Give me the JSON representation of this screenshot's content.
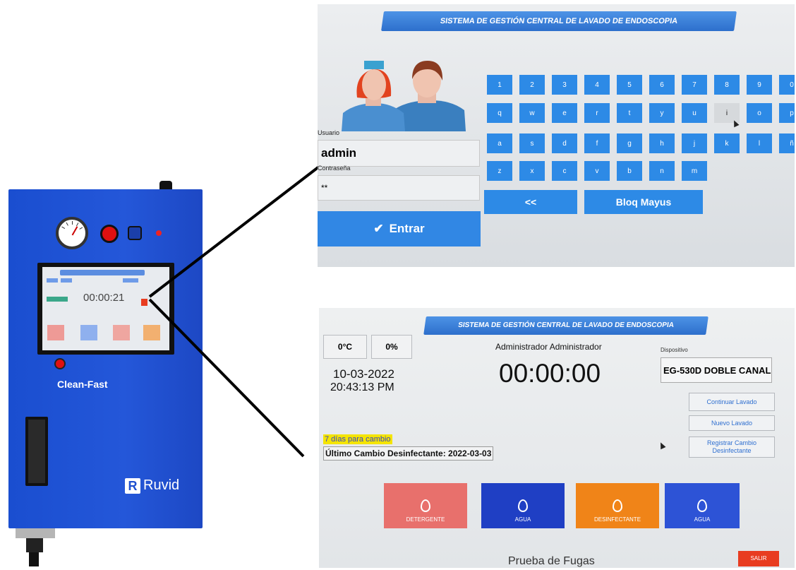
{
  "device": {
    "brand_label": "Clean-Fast",
    "logo_text": "Ruvid",
    "logo_mark": "R",
    "mini_screen_timer": "00:00:21",
    "body_color": "#1f50d0"
  },
  "login_screen": {
    "banner_title": "SISTEMA DE GESTIÓN CENTRAL DE LAVADO DE ENDOSCOPIA",
    "user_label": "Usuario",
    "user_value": "admin",
    "password_label": "Contraseña",
    "password_value": "**",
    "enter_button": "Entrar",
    "enter_icon": "check-icon",
    "keyboard": {
      "rows": [
        [
          "1",
          "2",
          "3",
          "4",
          "5",
          "6",
          "7",
          "8",
          "9",
          "0"
        ],
        [
          "q",
          "w",
          "e",
          "r",
          "t",
          "y",
          "u",
          "i",
          "o",
          "p"
        ],
        [
          "a",
          "s",
          "d",
          "f",
          "g",
          "h",
          "j",
          "k",
          "l",
          "ñ"
        ],
        [
          "z",
          "x",
          "c",
          "v",
          "b",
          "n",
          "m"
        ]
      ],
      "active_key": "i",
      "backspace_label": "<<",
      "caps_lock_label": "Bloq Mayus"
    },
    "key_color": "#2d8ae6"
  },
  "main_screen": {
    "banner_title": "SISTEMA DE GESTIÓN CENTRAL DE LAVADO DE ENDOSCOPIA",
    "temperature": "0°C",
    "humidity": "0%",
    "date": "10-03-2022",
    "time": "20:43:13 PM",
    "operator": "Administrador Administrador",
    "timer": "00:00:00",
    "device_label": "Dispositivo",
    "device_value": "EG-530D DOBLE CANAL",
    "continue_wash_label": "Continuar Lavado",
    "new_wash_label": "Nuevo Lavado",
    "register_change_label": "Registrar Cambio Desinfectante",
    "days_to_change": "7 días para cambio",
    "last_change": "Último Cambio Desinfectante: 2022-03-03",
    "stages": [
      {
        "label": "DETERGENTE",
        "color": "#e8706c",
        "icon": "detergent-icon"
      },
      {
        "label": "AGUA",
        "color": "#1f3fc4",
        "icon": "water-drop-icon"
      },
      {
        "label": "DESINFECTANTE",
        "color": "#f08418",
        "icon": "disinfectant-icon"
      },
      {
        "label": "AGUA",
        "color": "#2d53d6",
        "icon": "water-drop-icon"
      }
    ],
    "leak_test_label": "Prueba de Fugas",
    "exit_label": "SALIR"
  }
}
